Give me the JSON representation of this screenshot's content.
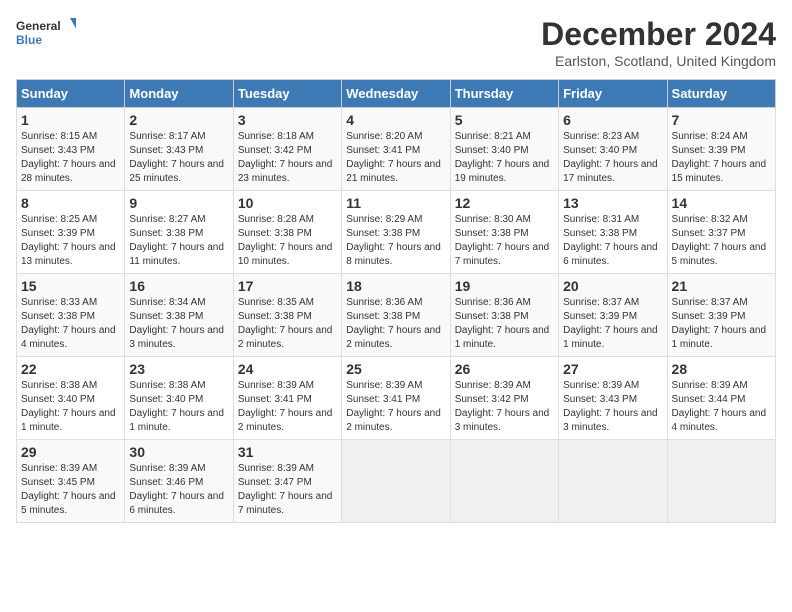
{
  "header": {
    "logo_line1": "General",
    "logo_line2": "Blue",
    "month_title": "December 2024",
    "subtitle": "Earlston, Scotland, United Kingdom"
  },
  "days_of_week": [
    "Sunday",
    "Monday",
    "Tuesday",
    "Wednesday",
    "Thursday",
    "Friday",
    "Saturday"
  ],
  "weeks": [
    [
      {
        "day": "1",
        "sunrise": "8:15 AM",
        "sunset": "3:43 PM",
        "daylight": "7 hours and 28 minutes."
      },
      {
        "day": "2",
        "sunrise": "8:17 AM",
        "sunset": "3:43 PM",
        "daylight": "7 hours and 25 minutes."
      },
      {
        "day": "3",
        "sunrise": "8:18 AM",
        "sunset": "3:42 PM",
        "daylight": "7 hours and 23 minutes."
      },
      {
        "day": "4",
        "sunrise": "8:20 AM",
        "sunset": "3:41 PM",
        "daylight": "7 hours and 21 minutes."
      },
      {
        "day": "5",
        "sunrise": "8:21 AM",
        "sunset": "3:40 PM",
        "daylight": "7 hours and 19 minutes."
      },
      {
        "day": "6",
        "sunrise": "8:23 AM",
        "sunset": "3:40 PM",
        "daylight": "7 hours and 17 minutes."
      },
      {
        "day": "7",
        "sunrise": "8:24 AM",
        "sunset": "3:39 PM",
        "daylight": "7 hours and 15 minutes."
      }
    ],
    [
      {
        "day": "8",
        "sunrise": "8:25 AM",
        "sunset": "3:39 PM",
        "daylight": "7 hours and 13 minutes."
      },
      {
        "day": "9",
        "sunrise": "8:27 AM",
        "sunset": "3:38 PM",
        "daylight": "7 hours and 11 minutes."
      },
      {
        "day": "10",
        "sunrise": "8:28 AM",
        "sunset": "3:38 PM",
        "daylight": "7 hours and 10 minutes."
      },
      {
        "day": "11",
        "sunrise": "8:29 AM",
        "sunset": "3:38 PM",
        "daylight": "7 hours and 8 minutes."
      },
      {
        "day": "12",
        "sunrise": "8:30 AM",
        "sunset": "3:38 PM",
        "daylight": "7 hours and 7 minutes."
      },
      {
        "day": "13",
        "sunrise": "8:31 AM",
        "sunset": "3:38 PM",
        "daylight": "7 hours and 6 minutes."
      },
      {
        "day": "14",
        "sunrise": "8:32 AM",
        "sunset": "3:37 PM",
        "daylight": "7 hours and 5 minutes."
      }
    ],
    [
      {
        "day": "15",
        "sunrise": "8:33 AM",
        "sunset": "3:38 PM",
        "daylight": "7 hours and 4 minutes."
      },
      {
        "day": "16",
        "sunrise": "8:34 AM",
        "sunset": "3:38 PM",
        "daylight": "7 hours and 3 minutes."
      },
      {
        "day": "17",
        "sunrise": "8:35 AM",
        "sunset": "3:38 PM",
        "daylight": "7 hours and 2 minutes."
      },
      {
        "day": "18",
        "sunrise": "8:36 AM",
        "sunset": "3:38 PM",
        "daylight": "7 hours and 2 minutes."
      },
      {
        "day": "19",
        "sunrise": "8:36 AM",
        "sunset": "3:38 PM",
        "daylight": "7 hours and 1 minute."
      },
      {
        "day": "20",
        "sunrise": "8:37 AM",
        "sunset": "3:39 PM",
        "daylight": "7 hours and 1 minute."
      },
      {
        "day": "21",
        "sunrise": "8:37 AM",
        "sunset": "3:39 PM",
        "daylight": "7 hours and 1 minute."
      }
    ],
    [
      {
        "day": "22",
        "sunrise": "8:38 AM",
        "sunset": "3:40 PM",
        "daylight": "7 hours and 1 minute."
      },
      {
        "day": "23",
        "sunrise": "8:38 AM",
        "sunset": "3:40 PM",
        "daylight": "7 hours and 1 minute."
      },
      {
        "day": "24",
        "sunrise": "8:39 AM",
        "sunset": "3:41 PM",
        "daylight": "7 hours and 2 minutes."
      },
      {
        "day": "25",
        "sunrise": "8:39 AM",
        "sunset": "3:41 PM",
        "daylight": "7 hours and 2 minutes."
      },
      {
        "day": "26",
        "sunrise": "8:39 AM",
        "sunset": "3:42 PM",
        "daylight": "7 hours and 3 minutes."
      },
      {
        "day": "27",
        "sunrise": "8:39 AM",
        "sunset": "3:43 PM",
        "daylight": "7 hours and 3 minutes."
      },
      {
        "day": "28",
        "sunrise": "8:39 AM",
        "sunset": "3:44 PM",
        "daylight": "7 hours and 4 minutes."
      }
    ],
    [
      {
        "day": "29",
        "sunrise": "8:39 AM",
        "sunset": "3:45 PM",
        "daylight": "7 hours and 5 minutes."
      },
      {
        "day": "30",
        "sunrise": "8:39 AM",
        "sunset": "3:46 PM",
        "daylight": "7 hours and 6 minutes."
      },
      {
        "day": "31",
        "sunrise": "8:39 AM",
        "sunset": "3:47 PM",
        "daylight": "7 hours and 7 minutes."
      },
      null,
      null,
      null,
      null
    ]
  ],
  "labels": {
    "sunrise": "Sunrise:",
    "sunset": "Sunset:",
    "daylight": "Daylight:"
  }
}
